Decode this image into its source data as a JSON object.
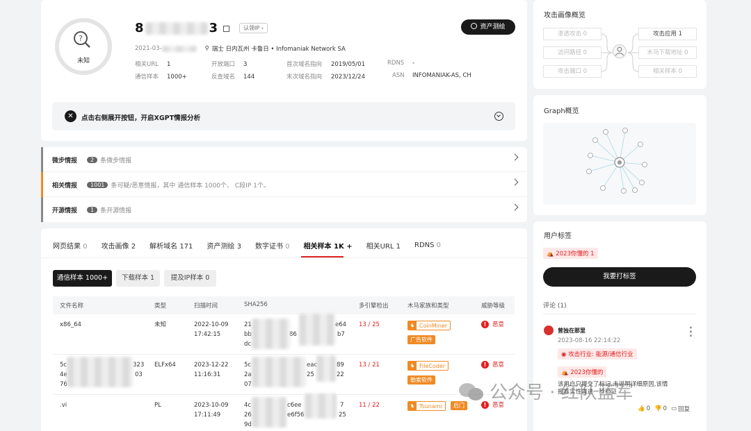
{
  "header": {
    "ip_prefix": "8",
    "ip_suffix": "3",
    "claim_ip": "认领IP",
    "asset_survey": "资产测绘",
    "status": "未知",
    "date_prefix": "2021-03-",
    "location": "瑞士 日内瓦州 卡鲁日 • Infomaniak Network SA",
    "stats": [
      {
        "label": "相关URL",
        "value": "1"
      },
      {
        "label": "开放端口",
        "value": "3"
      },
      {
        "label": "首次域名指向",
        "value": "2019/05/01"
      },
      {
        "label": "RDNS",
        "value": "-"
      },
      {
        "label": "通信样本",
        "value": "1000+"
      },
      {
        "label": "反查域名",
        "value": "144"
      },
      {
        "label": "末次域名指向",
        "value": "2023/12/24"
      },
      {
        "label": "ASN",
        "value": "INFOMANIAK-AS, CH"
      }
    ],
    "xgpt_text": "点击右侧展开按钮，开启XGPT情报分析"
  },
  "intel": [
    {
      "title": "微步情报",
      "count": "2",
      "desc": "条微步情报"
    },
    {
      "title": "相关情报",
      "count": "1001",
      "desc": "条可疑/恶意情报，其中 通信样本 1000个、 C段IP 1个。"
    },
    {
      "title": "开源情报",
      "count": "1",
      "desc": "条开源情报"
    }
  ],
  "tabs": [
    {
      "label": "网页结果",
      "count": "0"
    },
    {
      "label": "攻击画像",
      "count": "2"
    },
    {
      "label": "解析域名",
      "count": "171"
    },
    {
      "label": "资产测绘",
      "count": "3"
    },
    {
      "label": "数字证书",
      "count": "0"
    },
    {
      "label": "相关样本",
      "count": "1K +"
    },
    {
      "label": "相关URL",
      "count": "1"
    },
    {
      "label": "RDNS",
      "count": "0"
    }
  ],
  "subtabs": [
    "通信样本 1000+",
    "下载样本 1",
    "提及IP样本 0"
  ],
  "table": {
    "headers": [
      "文件名称",
      "类型",
      "扫描时间",
      "SHA256",
      "多引擎检出",
      "木马家族和类型",
      "威胁等级"
    ],
    "rows": [
      {
        "name": "x86_64",
        "type": "未知",
        "date": "2022-10-09",
        "time": "17:42:15",
        "sha": [
          "21",
          "e64",
          "bb",
          "86",
          "b7",
          "dc"
        ],
        "detect": "13 / 25",
        "family": "CoinMiner",
        "ftag": "广告软件",
        "threat": "恶意"
      },
      {
        "name": "",
        "type": "ELFx64",
        "date": "2023-12-22",
        "time": "11:16:31",
        "sha": [
          "5c",
          "eac",
          "89",
          "2a",
          "25",
          "22",
          "07"
        ],
        "name_frag": [
          "5c",
          "323",
          "4e",
          "03",
          "76"
        ],
        "detect": "13 / 21",
        "family": "FileCoder",
        "ftag": "勒索软件",
        "threat": "恶意"
      },
      {
        "name": ".vi",
        "type": "PL",
        "date": "2023-10-09",
        "time": "17:11:49",
        "sha": [
          "4c",
          "c6ee",
          "7",
          "26",
          "e6f56",
          "25",
          "9d"
        ],
        "detect": "11 / 22",
        "family": "Tsunami",
        "ftag": "后门",
        "threat": "恶意"
      }
    ]
  },
  "attack_profile": {
    "title": "攻击画像概览",
    "left": [
      "渗透攻击 0",
      "访问路径 0",
      "攻击端口 0"
    ],
    "right": [
      "攻击应用 1",
      "木马下载地址 0",
      "相关样本 0"
    ]
  },
  "graph": {
    "title": "Graph概览"
  },
  "user_tags": {
    "title": "用户标签",
    "tag": "2023你懂的 1",
    "button": "我要打标签",
    "comments_title": "评论 (1)",
    "comment": {
      "user": "曾独在那里",
      "time": "2023-08-16 22:14:22",
      "tag1": "攻击行业: 能源/通信行业",
      "tag2": "2023你懂的",
      "text": "该用户只提交了标记,未说明详细原因,该情报真实性需进一步验证",
      "likes": "0",
      "dislikes": "0",
      "reply": "回复"
    }
  },
  "watermark": "公众号 · 红队蓝军",
  "colors": {
    "accent": "#e02020",
    "orange": "#f08a24",
    "dark": "#1a1a1a"
  }
}
